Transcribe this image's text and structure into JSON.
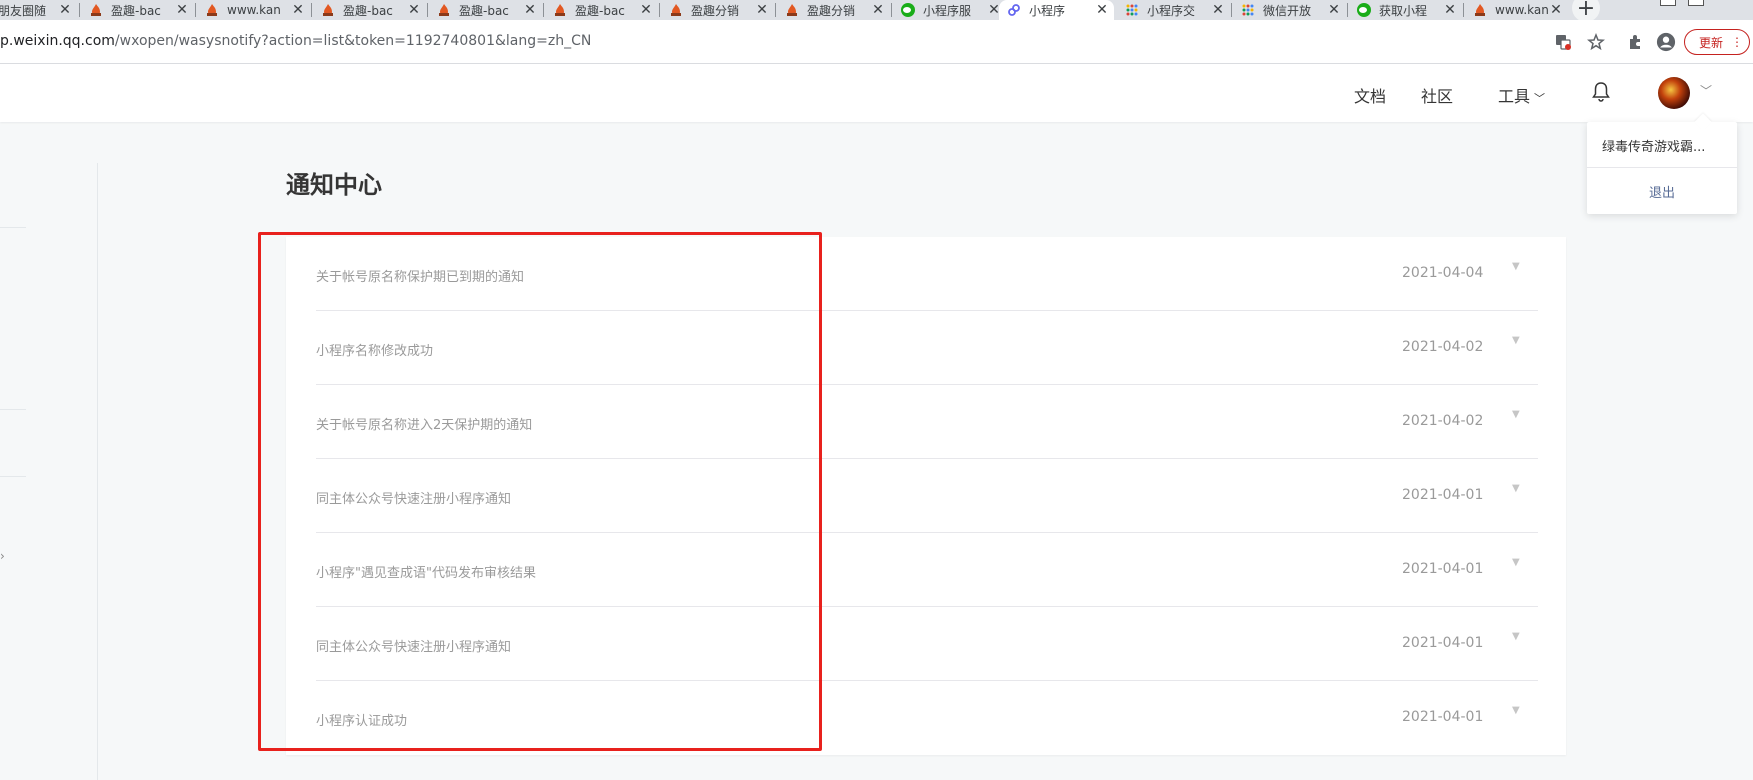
{
  "browser": {
    "tabs": [
      {
        "title": "朋友圈随",
        "favicon": "moments-icon"
      },
      {
        "title": "盈趣-bac",
        "favicon": "fire-icon"
      },
      {
        "title": "www.kan",
        "favicon": "fire-icon"
      },
      {
        "title": "盈趣-bac",
        "favicon": "fire-icon"
      },
      {
        "title": "盈趣-bac",
        "favicon": "fire-icon"
      },
      {
        "title": "盈趣-bac",
        "favicon": "fire-icon"
      },
      {
        "title": "盈趣分销",
        "favicon": "fire-icon"
      },
      {
        "title": "盈趣分销",
        "favicon": "fire-icon"
      },
      {
        "title": "小程序服",
        "favicon": "wechat-icon"
      },
      {
        "title": "小程序",
        "favicon": "miniprogram-icon",
        "active": true
      },
      {
        "title": "小程序交",
        "favicon": "dots-grid-icon"
      },
      {
        "title": "微信开放",
        "favicon": "dots-grid-icon"
      },
      {
        "title": "获取小程",
        "favicon": "wechat-icon"
      },
      {
        "title": "www.kan",
        "favicon": "fire-icon"
      }
    ],
    "url_host": "p.weixin.qq.com",
    "url_path": "/wxopen/wasysnotify?action=list&token=1192740801&lang=zh_CN",
    "update_label": "更新"
  },
  "header": {
    "nav": [
      {
        "label": "文档"
      },
      {
        "label": "社区"
      },
      {
        "label": "工具"
      }
    ]
  },
  "account_menu": {
    "username": "绿毒传奇游戏霸...",
    "logout_label": "退出"
  },
  "page": {
    "title": "通知中心"
  },
  "notifications": [
    {
      "title": "关于帐号原名称保护期已到期的通知",
      "date": "2021-04-04"
    },
    {
      "title": "小程序名称修改成功",
      "date": "2021-04-02"
    },
    {
      "title": "关于帐号原名称进入2天保护期的通知",
      "date": "2021-04-02"
    },
    {
      "title": "同主体公众号快速注册小程序通知",
      "date": "2021-04-01"
    },
    {
      "title": "小程序\"遇见查成语\"代码发布审核结果",
      "date": "2021-04-01"
    },
    {
      "title": "同主体公众号快速注册小程序通知",
      "date": "2021-04-01"
    },
    {
      "title": "小程序认证成功",
      "date": "2021-04-01"
    }
  ],
  "colors": {
    "highlight_border": "#e8211d",
    "link": "#576b95",
    "muted_text": "#9a9a9a"
  }
}
